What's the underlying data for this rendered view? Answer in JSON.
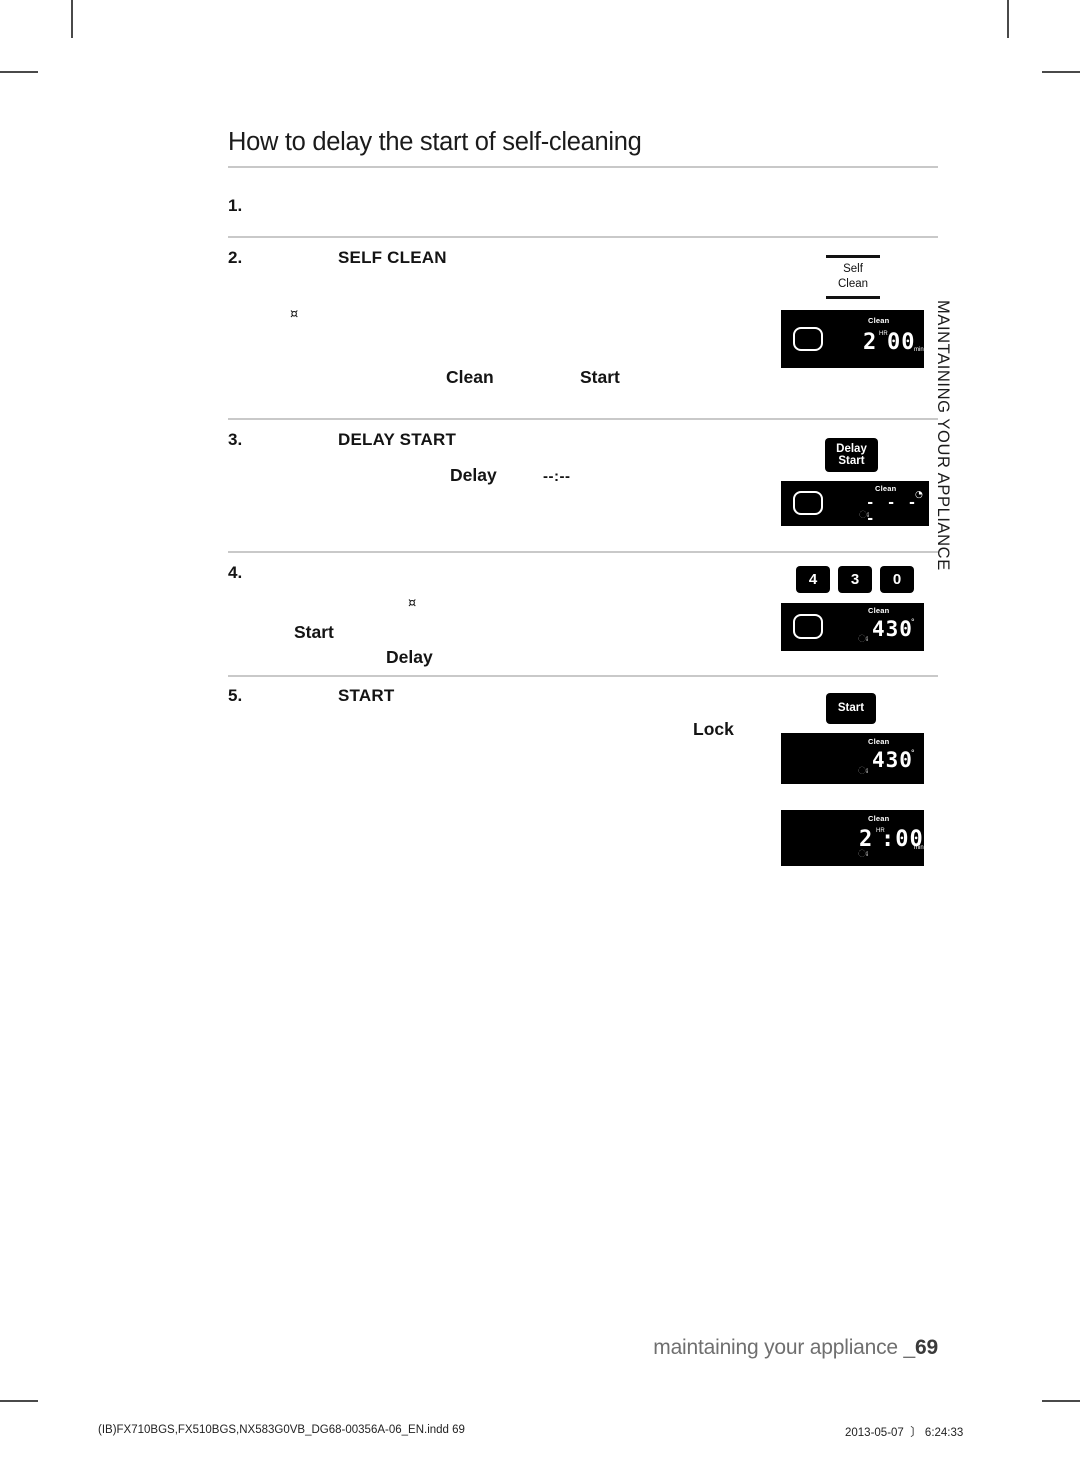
{
  "document": {
    "title": "How to delay the start of self-cleaning",
    "side_tab": "MAINTAINING YOUR APPLIANCE",
    "footer_text": "maintaining your appliance _",
    "footer_page": "69",
    "print_file": "(IB)FX710BGS,FX510BGS,NX583G0VB_DG68-00356A-06_EN.indd   69",
    "print_date": "2013-05-07",
    "print_time": "6:24:33",
    "print_time_glyph": "〕"
  },
  "steps": [
    {
      "number": "1.",
      "heading": "",
      "words": []
    },
    {
      "number": "2.",
      "heading": "SELF CLEAN",
      "bullet": "¤",
      "words": [
        {
          "text": "Clean"
        },
        {
          "text": "Start"
        }
      ]
    },
    {
      "number": "3.",
      "heading": "DELAY START",
      "words": [
        {
          "text": "Delay"
        },
        {
          "text": "--:--"
        }
      ]
    },
    {
      "number": "4.",
      "heading": "",
      "bullet": "¤",
      "words": [
        {
          "text": "Start"
        },
        {
          "text": "Delay"
        }
      ]
    },
    {
      "number": "5.",
      "heading": "START",
      "words": [
        {
          "text": "Lock"
        }
      ]
    }
  ],
  "graphics": {
    "self_clean_bracket": {
      "line1": "Self",
      "line2": "Clean"
    },
    "buttons": {
      "delay_start_line1": "Delay",
      "delay_start_line2": "Start",
      "start": "Start"
    },
    "keypad": [
      "4",
      "3",
      "0"
    ],
    "displays": [
      {
        "id": "display-clean-2hr-00min",
        "label": "Clean",
        "value": "2",
        "unit_top": "HR",
        "value2": "00",
        "unit_end": "min",
        "lock": false
      },
      {
        "id": "display-clean-delay-dashes",
        "label": "Clean",
        "dashes": "- - - -",
        "clock": "◔",
        "lock": true
      },
      {
        "id": "display-clean-430",
        "label": "Clean",
        "value": "430",
        "degree": "°",
        "lock": true
      },
      {
        "id": "display-clean-430-locked",
        "label": "Clean",
        "value": "430",
        "degree": "°",
        "lock": true
      },
      {
        "id": "display-clean-2hr-00min-locked",
        "label": "Clean",
        "value": "2",
        "unit_top": "HR",
        "value2": ":00",
        "unit_end": "min",
        "lock": true
      }
    ],
    "lock_icon": "ඃ",
    "icons": {
      "lock": "lock-icon",
      "clock": "clock-icon"
    }
  }
}
